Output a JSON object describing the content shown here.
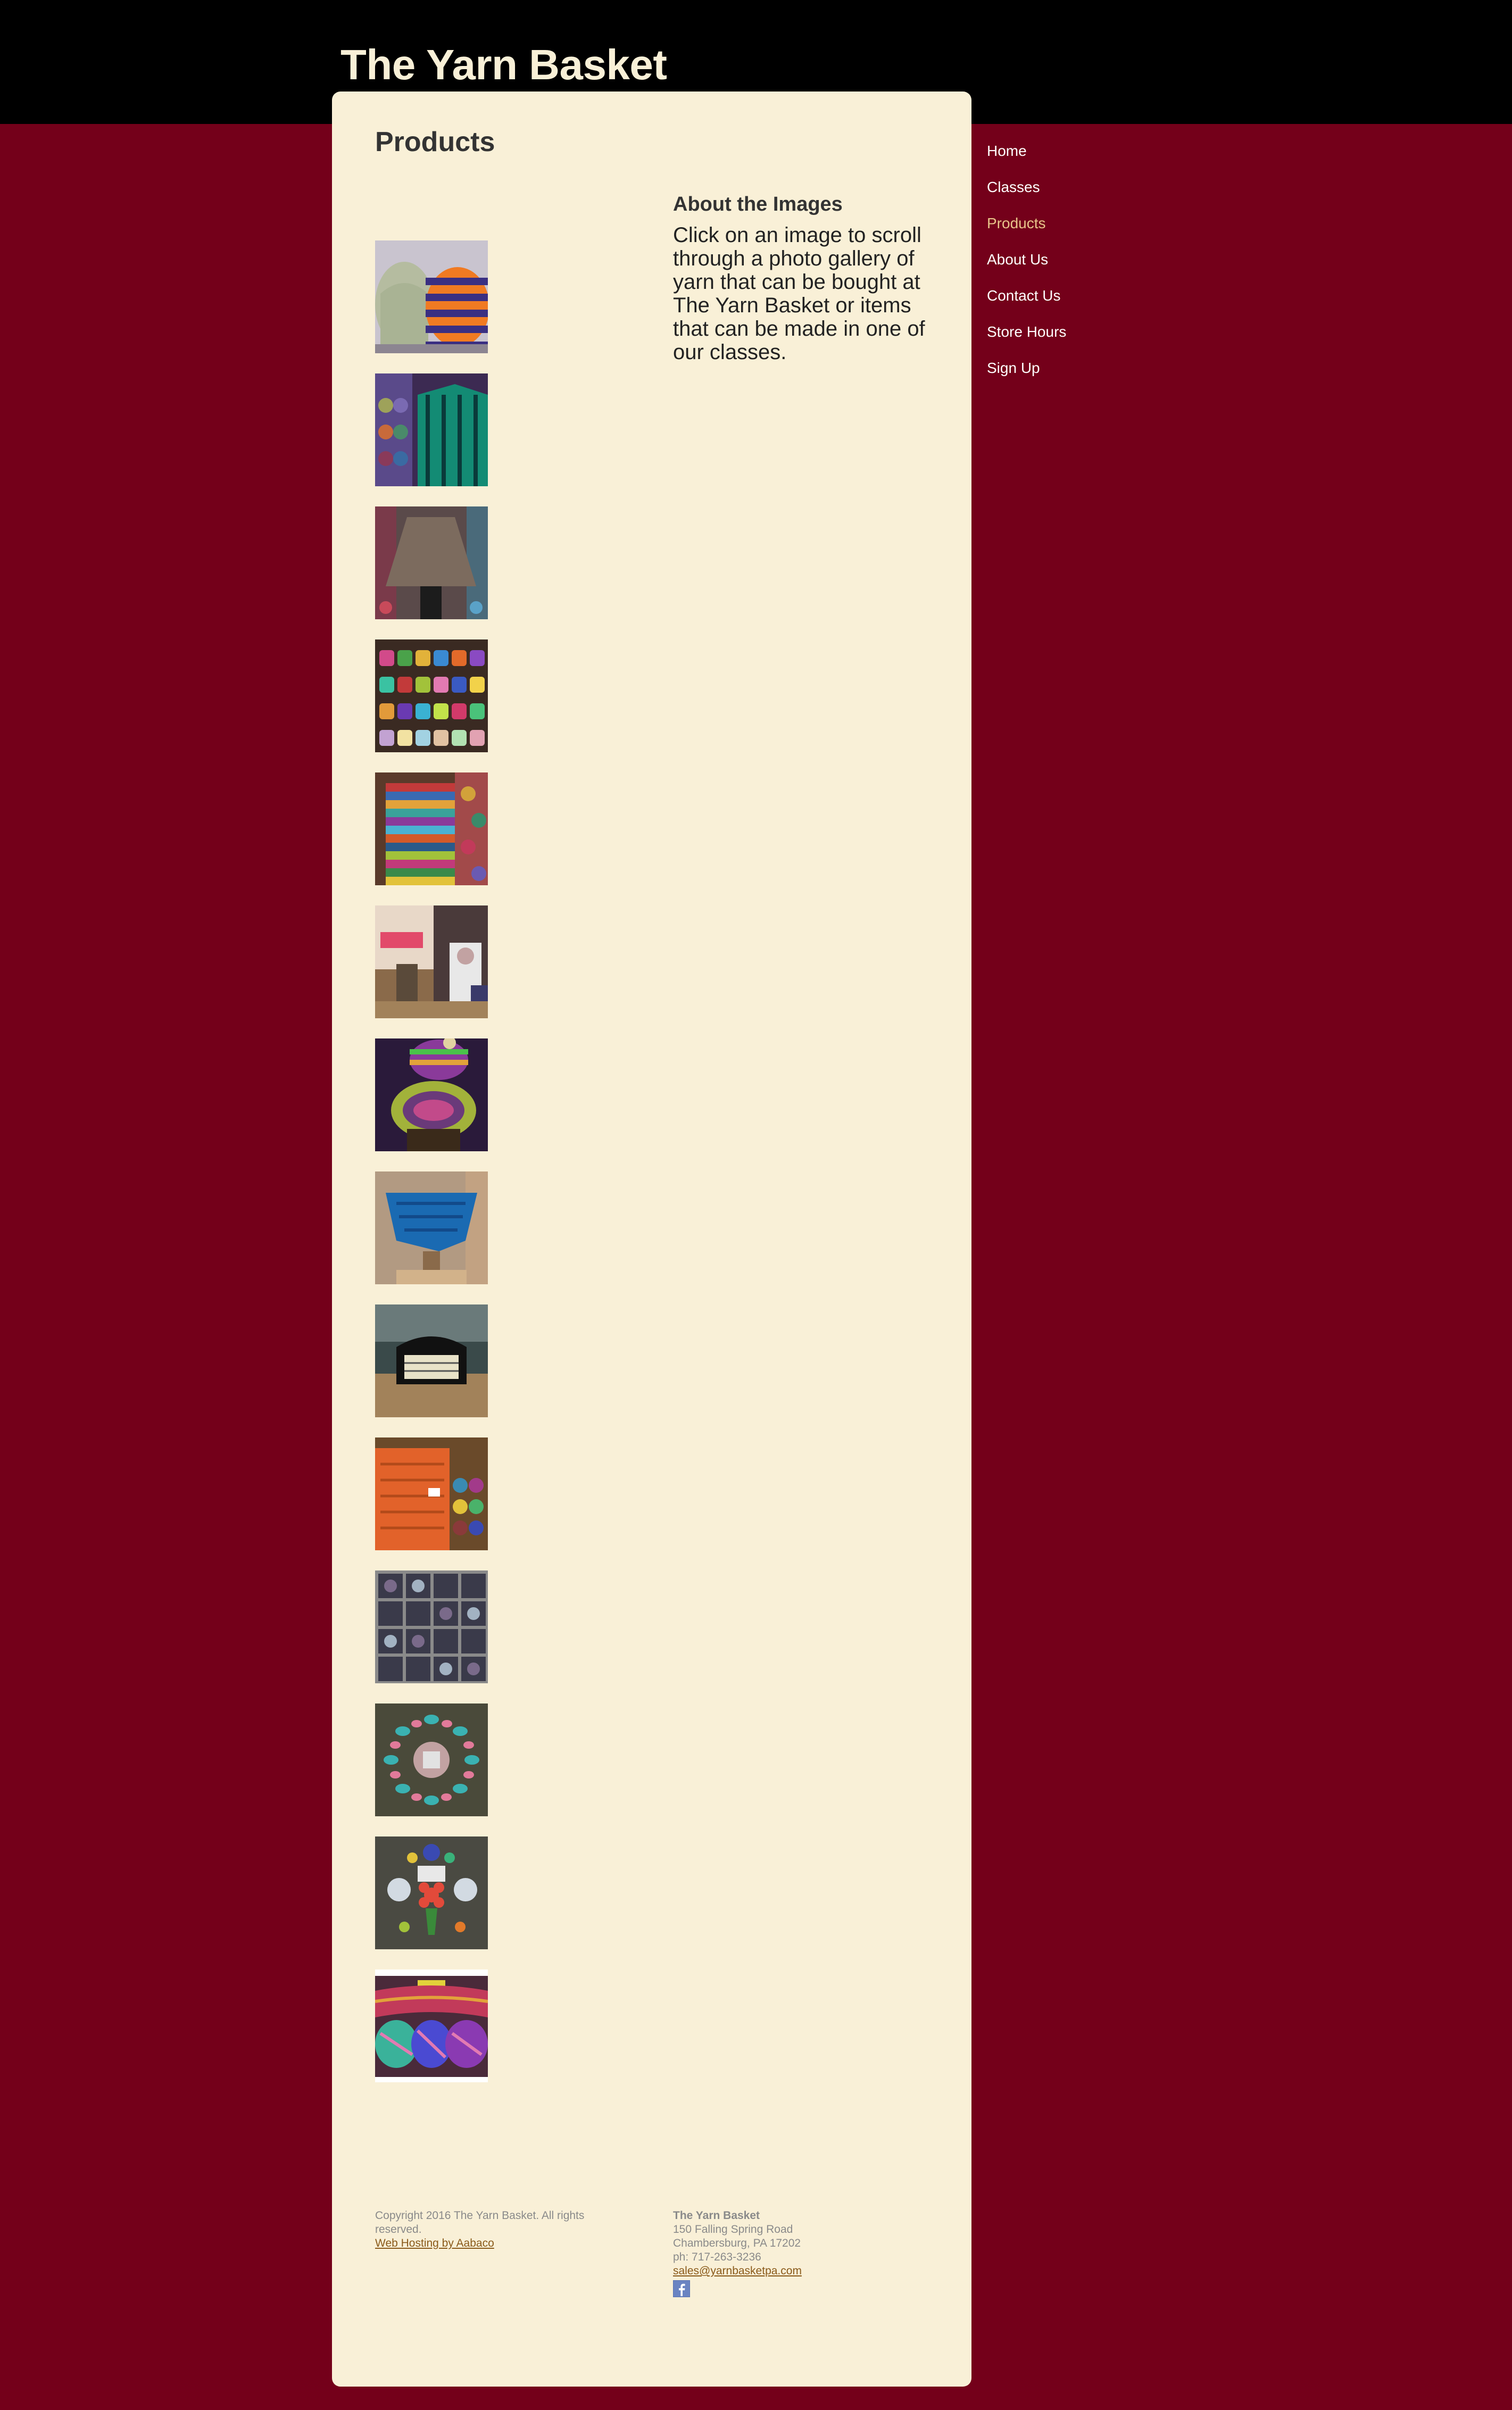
{
  "site": {
    "title": "The Yarn Basket"
  },
  "page": {
    "heading": "Products"
  },
  "gallery": {
    "items": [
      {
        "name": "knit-hats-thumbnail"
      },
      {
        "name": "yarn-shelves-sweater-thumbnail"
      },
      {
        "name": "gray-poncho-thumbnail"
      },
      {
        "name": "yarn-wall-thumbnail"
      },
      {
        "name": "striped-sweater-thumbnail"
      },
      {
        "name": "katia-display-thumbnail"
      },
      {
        "name": "hat-and-cowl-thumbnail"
      },
      {
        "name": "blue-shawl-thumbnail"
      },
      {
        "name": "knitting-bag-thumbnail"
      },
      {
        "name": "orange-shawl-thumbnail"
      },
      {
        "name": "yarn-cubbies-thumbnail"
      },
      {
        "name": "knit-spiral-thumbnail"
      },
      {
        "name": "knit-flowers-thumbnail"
      },
      {
        "name": "multicolor-skeins-thumbnail"
      }
    ]
  },
  "about": {
    "heading": "About the Images",
    "text": "Click on an image to scroll through a photo gallery of yarn that can be bought at The Yarn Basket or items that can be made in one of our classes."
  },
  "nav": {
    "items": [
      {
        "label": "Home",
        "active": false
      },
      {
        "label": "Classes",
        "active": false
      },
      {
        "label": "Products",
        "active": true
      },
      {
        "label": "About Us",
        "active": false
      },
      {
        "label": "Contact Us",
        "active": false
      },
      {
        "label": "Store Hours",
        "active": false
      },
      {
        "label": "Sign Up",
        "active": false
      }
    ]
  },
  "footer": {
    "copyright": "Copyright 2016 The Yarn Basket. All rights reserved.",
    "hosting_link": "Web Hosting by Aabaco",
    "business_name": "The Yarn Basket",
    "address_line1": "150 Falling Spring Road",
    "address_line2": "Chambersburg, PA 17202",
    "phone": "ph: 717-263-3236",
    "email": "sales@yarnbasketpa.com",
    "social_icon": "facebook-icon"
  },
  "colors": {
    "page_background": "#74001a",
    "header_background": "#000000",
    "panel_background": "#f9f0d7",
    "title_color": "#f9f0d7",
    "nav_active": "#e8c58a"
  }
}
